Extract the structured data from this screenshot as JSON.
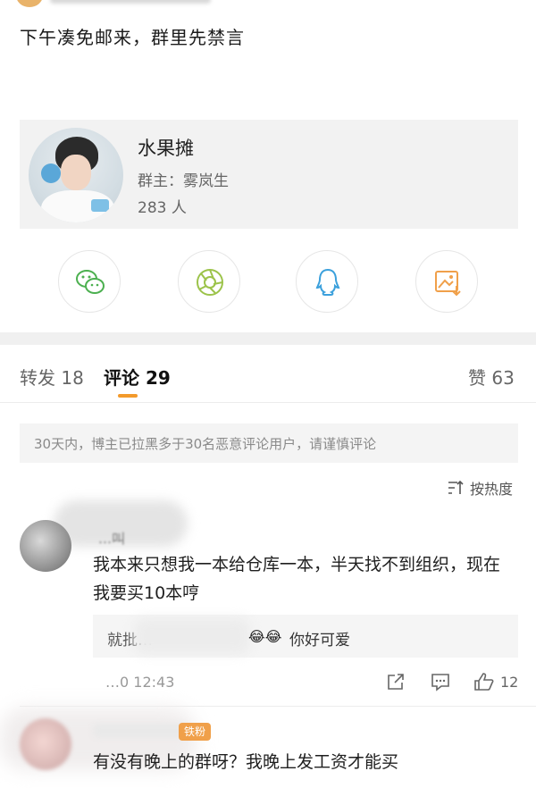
{
  "post": {
    "text": "下午凑免邮来，群里先禁言"
  },
  "group_card": {
    "name": "水果摊",
    "owner": "群主：雾岚生",
    "member_count": "283 人"
  },
  "share": {
    "icons": [
      "wechat-icon",
      "moments-icon",
      "qq-icon",
      "save-image-icon"
    ]
  },
  "tabs": {
    "repost": "转发 18",
    "comment": "评论 29",
    "like": "赞 63"
  },
  "notice": {
    "text": "30天内，博主已拉黑多于30名恶意评论用户，请谨慎评论"
  },
  "sort": {
    "label": "按热度"
  },
  "comments": [
    {
      "name_partial": "…叫",
      "text": "我本来只想我一本给仓库一本，半天找不到组织，现在我要买10本哼",
      "reply": {
        "name_partial": "就批…",
        "emoji": "😂😂",
        "text": "你好可爱"
      },
      "time": "…0 12:43",
      "likes": "12"
    },
    {
      "badge": "铁粉",
      "text": "有没有晚上的群呀？我晚上发工资才能买"
    }
  ],
  "colors": {
    "accent": "#f39a2b",
    "badge": "#f0a04a",
    "card_bg": "#f2f2f2"
  }
}
